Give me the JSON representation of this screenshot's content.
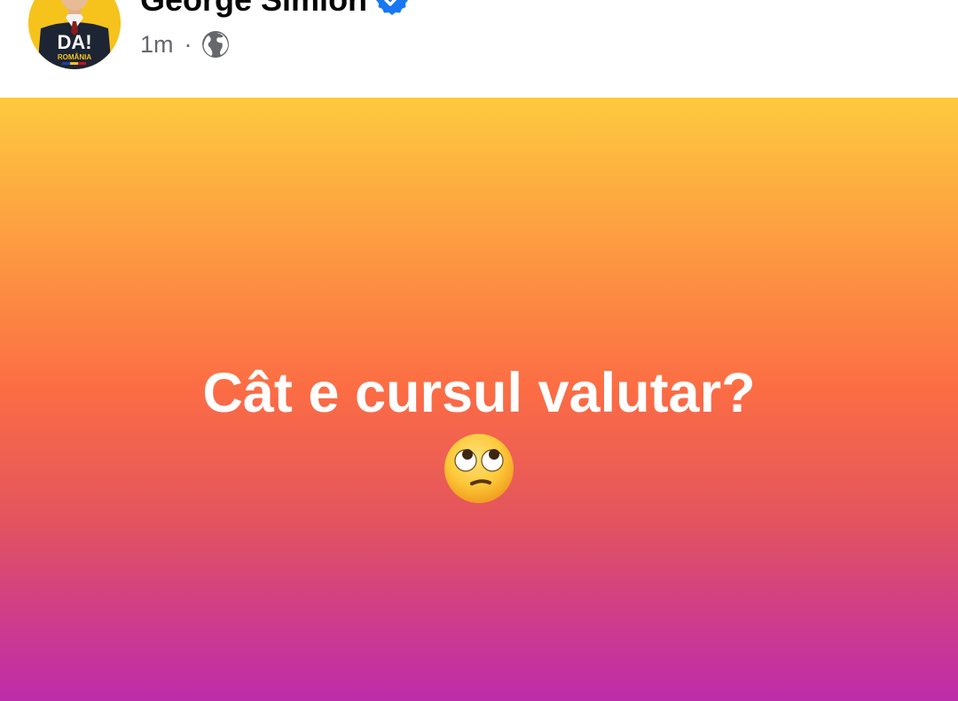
{
  "post": {
    "author": {
      "name": "George Simion",
      "verified": true,
      "avatar_logo_text": "DA!",
      "avatar_logo_subtext": "ROMÂNIA"
    },
    "timestamp": "1m",
    "separator": "·",
    "audience_icon": "globe-icon",
    "text": "Cât e cursul valutar?",
    "emoji": "face-with-rolling-eyes",
    "background_gradient": [
      "#fdca3e",
      "#fd9a42",
      "#fc6d44",
      "#e3545e",
      "#cc3a8f",
      "#bd2ca9"
    ]
  },
  "colors": {
    "verified_badge": "#1877f2",
    "avatar_background": "#f5c31c",
    "name_text": "#050505",
    "meta_text": "#65676b"
  }
}
